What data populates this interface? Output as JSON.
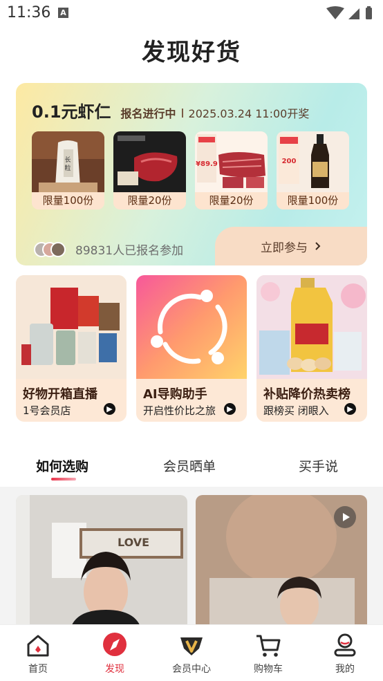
{
  "status": {
    "time": "11:36",
    "notif_icon": "A"
  },
  "page": {
    "title": "发现好货"
  },
  "promo": {
    "title": "0.1元虾仁",
    "status": "报名进行中",
    "date": "2025.03.24 11:00开奖",
    "products": [
      {
        "label": "限量100份",
        "icon": "rice-bag-image"
      },
      {
        "label": "限量20份",
        "icon": "beef-image"
      },
      {
        "label": "限量20份",
        "icon": "steak-image"
      },
      {
        "label": "限量100份",
        "icon": "soy-sauce-image"
      }
    ],
    "joined_text": "89831人已报名参加",
    "join_button": "立即参与"
  },
  "features": [
    {
      "title": "好物开箱直播",
      "subtitle": "1号会员店",
      "icon": "unboxing-image"
    },
    {
      "title": "AI导购助手",
      "subtitle": "开启性价比之旅",
      "icon": "ai-assistant-image"
    },
    {
      "title": "补贴降价热卖榜",
      "subtitle": "跟榜买 闭眼入",
      "icon": "oil-eggs-image"
    }
  ],
  "tabs": [
    {
      "label": "如何选购",
      "active": true
    },
    {
      "label": "会员晒单",
      "active": false
    },
    {
      "label": "买手说",
      "active": false
    }
  ],
  "nav": [
    {
      "label": "首页",
      "icon": "home-icon",
      "active": false
    },
    {
      "label": "发现",
      "icon": "discover-icon",
      "active": true
    },
    {
      "label": "会员中心",
      "icon": "member-icon",
      "active": false
    },
    {
      "label": "购物车",
      "icon": "cart-icon",
      "active": false
    },
    {
      "label": "我的",
      "icon": "profile-icon",
      "active": false
    }
  ],
  "colors": {
    "accent": "#e0303e",
    "promo_label_bg": "#fde4cf",
    "feature_bg": "#fde8d6"
  }
}
